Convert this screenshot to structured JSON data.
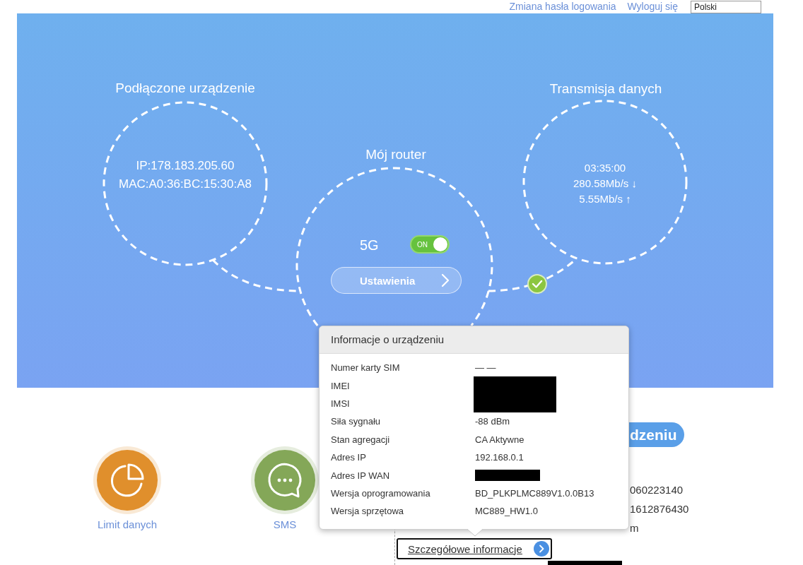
{
  "top_links": [
    {
      "label": "Zmiana hasła logowania"
    },
    {
      "label": "Wyloguj się"
    }
  ],
  "language_select": {
    "value": "Polski"
  },
  "diagram": {
    "connected_device": {
      "title": "Podłączone urządzenie",
      "lines": [
        "IP:178.183.205.60",
        "MAC:A0:36:BC:15:30:A8"
      ]
    },
    "router": {
      "title": "Mój router",
      "band_label": "5G",
      "band_switch": {
        "label": "ON",
        "on": true
      },
      "settings_button": "Ustawienia"
    },
    "data_transfer": {
      "title": "Transmisja danych",
      "lines": [
        "03:35:00",
        "280.58Mb/s ↓",
        "5.55Mb/s ↑"
      ]
    },
    "connection_ok": true
  },
  "shortcuts": [
    {
      "label": "Limit danych",
      "kind": "data-limit",
      "color": "#e08f2c"
    },
    {
      "label": "SMS",
      "kind": "sms",
      "color": "#84a758"
    }
  ],
  "device_panel": {
    "button": "dzeniu",
    "values": [
      "060223140",
      "1612876430",
      "m"
    ],
    "details_link": "Szczegółowe informacje"
  },
  "device_info_popup": {
    "title": "Informacje o urządzeniu",
    "rows": [
      {
        "label": "Numer karty SIM",
        "value": "— —",
        "redacted": false
      },
      {
        "label": "IMEI",
        "redacted": true
      },
      {
        "label": "IMSI",
        "redacted": true
      },
      {
        "label": "Siła sygnału",
        "value": "-88 dBm",
        "redacted": false
      },
      {
        "label": "Stan agregacji",
        "value": "CA Aktywne",
        "redacted": false
      },
      {
        "label": "Adres IP",
        "value": "192.168.0.1",
        "redacted": false
      },
      {
        "label": "Adres IP WAN",
        "redacted": true
      },
      {
        "label": "Wersja oprogramowania",
        "value": "BD_PLKPLMC889V1.0.0B13",
        "redacted": false
      },
      {
        "label": "Wersja sprzętowa",
        "value": "MC889_HW1.0",
        "redacted": false
      }
    ]
  }
}
